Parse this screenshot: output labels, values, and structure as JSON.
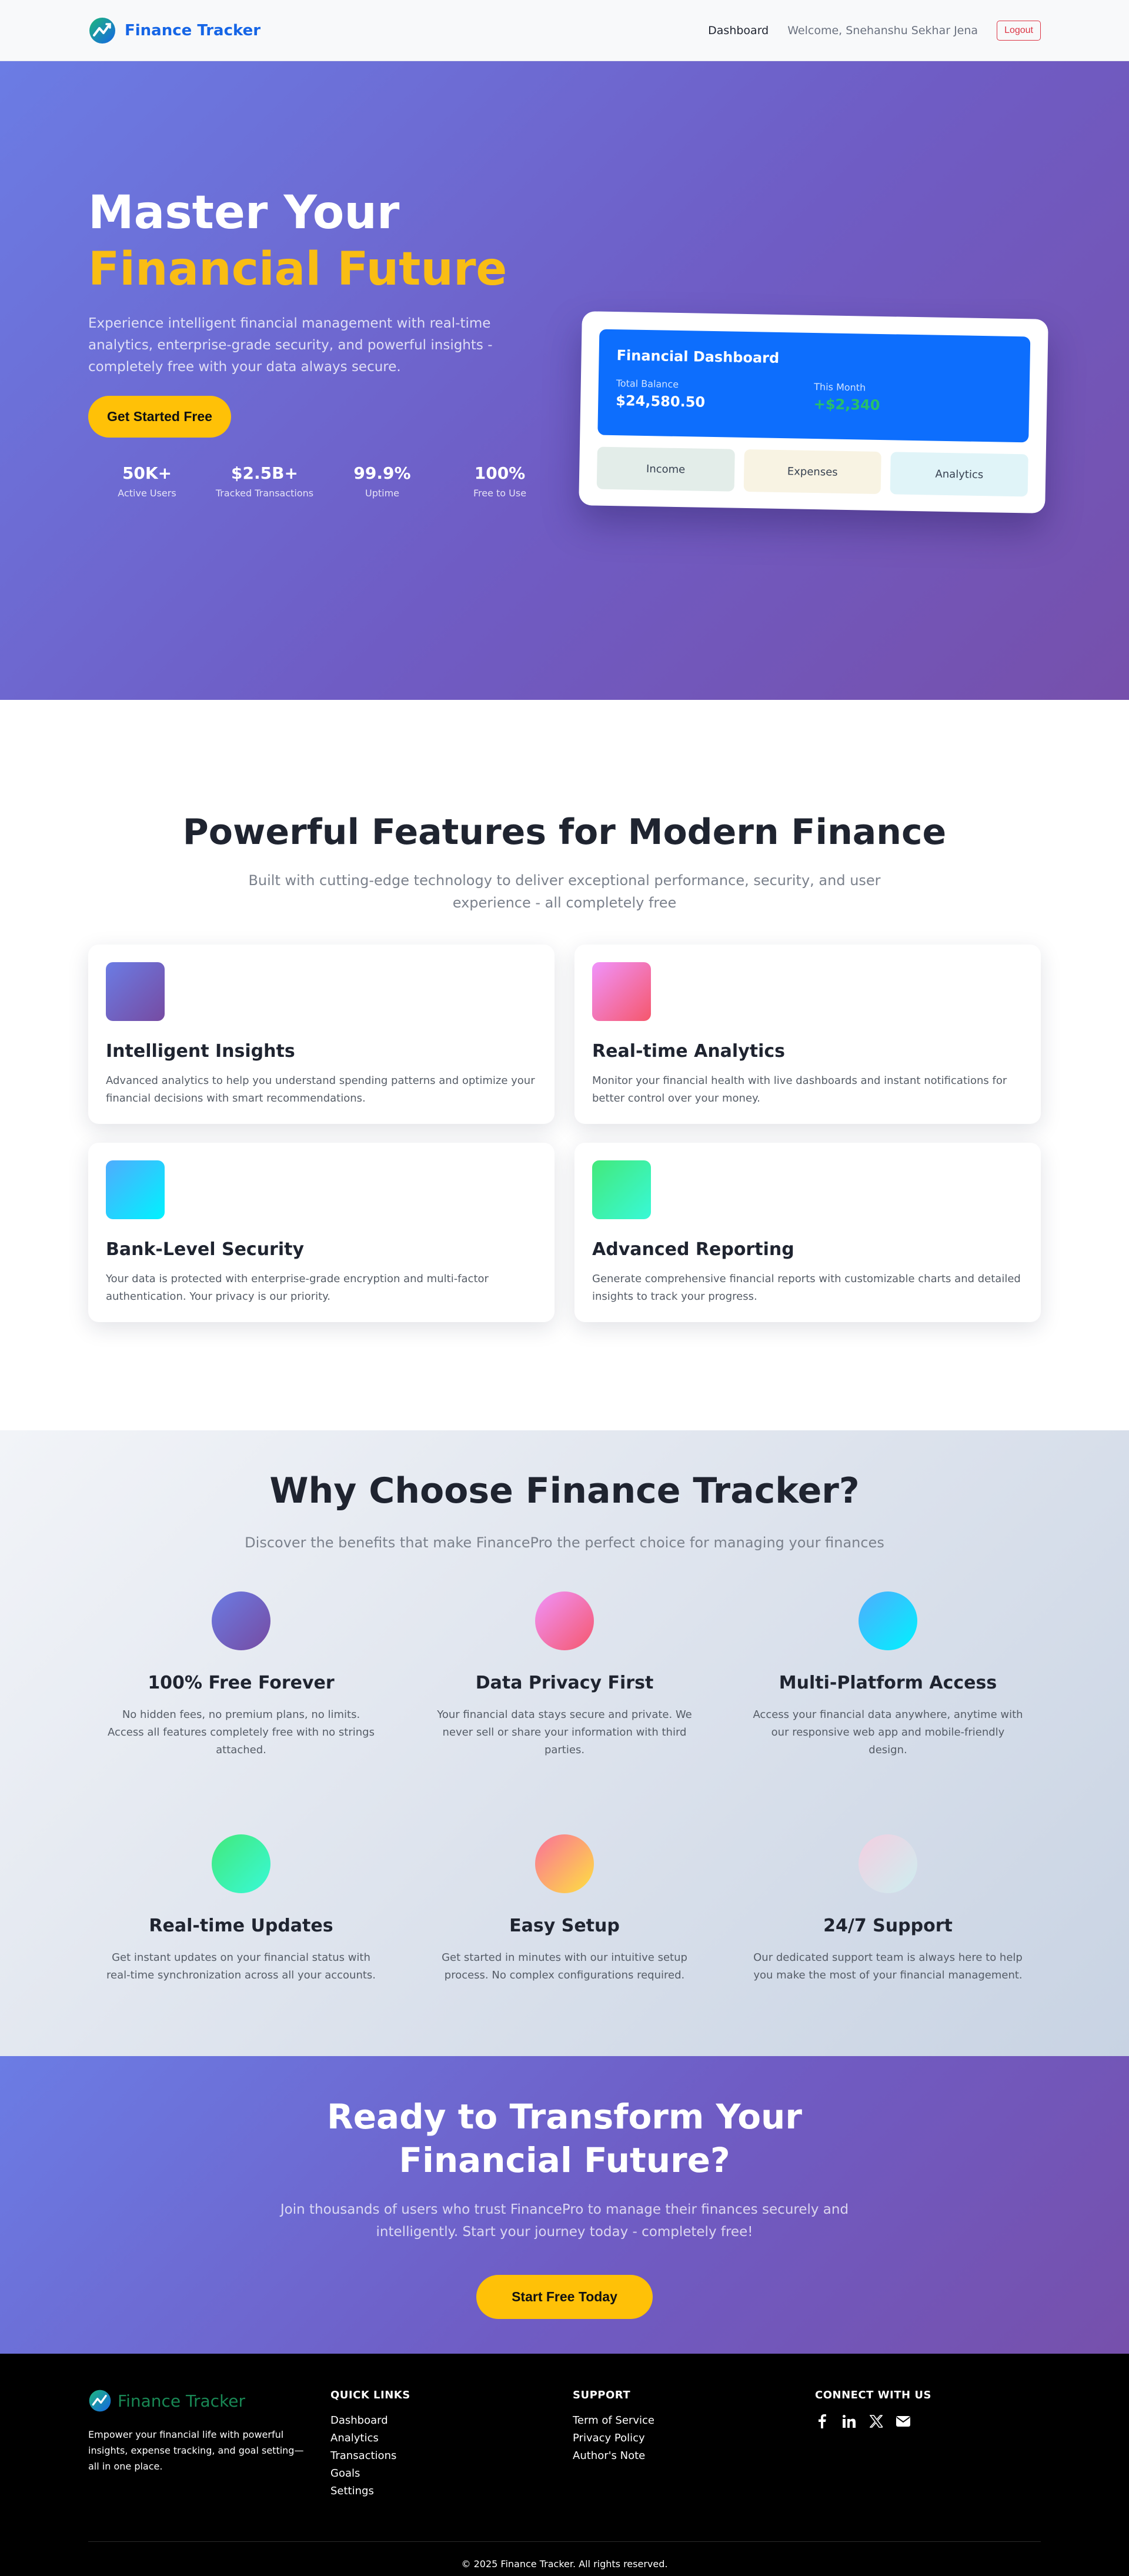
{
  "nav": {
    "brand": "Finance Tracker",
    "dashboard_link": "Dashboard",
    "welcome": "Welcome, Snehanshu Sekhar Jena",
    "logout": "Logout"
  },
  "hero": {
    "title_line1": "Master Your",
    "title_line2": "Financial Future",
    "subtitle": "Experience intelligent financial management with real-time analytics, enterprise-grade security, and powerful insights - completely free with your data always secure.",
    "cta": "Get Started Free",
    "stats": [
      {
        "value": "50K+",
        "label": "Active Users"
      },
      {
        "value": "$2.5B+",
        "label": "Tracked Transactions"
      },
      {
        "value": "99.9%",
        "label": "Uptime"
      },
      {
        "value": "100%",
        "label": "Free to Use"
      }
    ],
    "dashboard": {
      "title": "Financial Dashboard",
      "balance_label": "Total Balance",
      "balance_value": "$24,580.50",
      "month_label": "This Month",
      "month_value": "+$2,340",
      "tabs": [
        "Income",
        "Expenses",
        "Analytics"
      ]
    }
  },
  "features": {
    "title": "Powerful Features for Modern Finance",
    "subtitle": "Built with cutting-edge technology to deliver exceptional performance, security, and user experience - all completely free",
    "cards": [
      {
        "title": "Intelligent Insights",
        "desc": "Advanced analytics to help you understand spending patterns and optimize your financial decisions with smart recommendations."
      },
      {
        "title": "Real-time Analytics",
        "desc": "Monitor your financial health with live dashboards and instant notifications for better control over your money."
      },
      {
        "title": "Bank-Level Security",
        "desc": "Your data is protected with enterprise-grade encryption and multi-factor authentication. Your privacy is our priority."
      },
      {
        "title": "Advanced Reporting",
        "desc": "Generate comprehensive financial reports with customizable charts and detailed insights to track your progress."
      }
    ]
  },
  "why": {
    "title": "Why Choose Finance Tracker?",
    "subtitle": "Discover the benefits that make FinancePro the perfect choice for managing your finances",
    "items": [
      {
        "title": "100% Free Forever",
        "desc": "No hidden fees, no premium plans, no limits. Access all features completely free with no strings attached."
      },
      {
        "title": "Data Privacy First",
        "desc": "Your financial data stays secure and private. We never sell or share your information with third parties."
      },
      {
        "title": "Multi-Platform Access",
        "desc": "Access your financial data anywhere, anytime with our responsive web app and mobile-friendly design."
      },
      {
        "title": "Real-time Updates",
        "desc": "Get instant updates on your financial status with real-time synchronization across all your accounts."
      },
      {
        "title": "Easy Setup",
        "desc": "Get started in minutes with our intuitive setup process. No complex configurations required."
      },
      {
        "title": "24/7 Support",
        "desc": "Our dedicated support team is always here to help you make the most of your financial management."
      }
    ]
  },
  "cta": {
    "title": "Ready to Transform Your Financial Future?",
    "subtitle": "Join thousands of users who trust FinancePro to manage their finances securely and intelligently. Start your journey today - completely free!",
    "button": "Start Free Today"
  },
  "footer": {
    "brand": "Finance Tracker",
    "desc": "Empower your financial life with powerful insights, expense tracking, and goal setting—all in one place.",
    "quick_links_heading": "QUICK LINKS",
    "quick_links": [
      "Dashboard",
      "Analytics",
      "Transactions",
      "Goals",
      "Settings"
    ],
    "support_heading": "SUPPORT",
    "support_links": [
      "Term of Service",
      "Privacy Policy",
      "Author's Note"
    ],
    "connect_heading": "CONNECT WITH US",
    "socials": [
      "facebook-icon",
      "linkedin-icon",
      "x-icon",
      "email-icon"
    ],
    "copyright": "© 2025 Finance Tracker. All rights reserved."
  }
}
